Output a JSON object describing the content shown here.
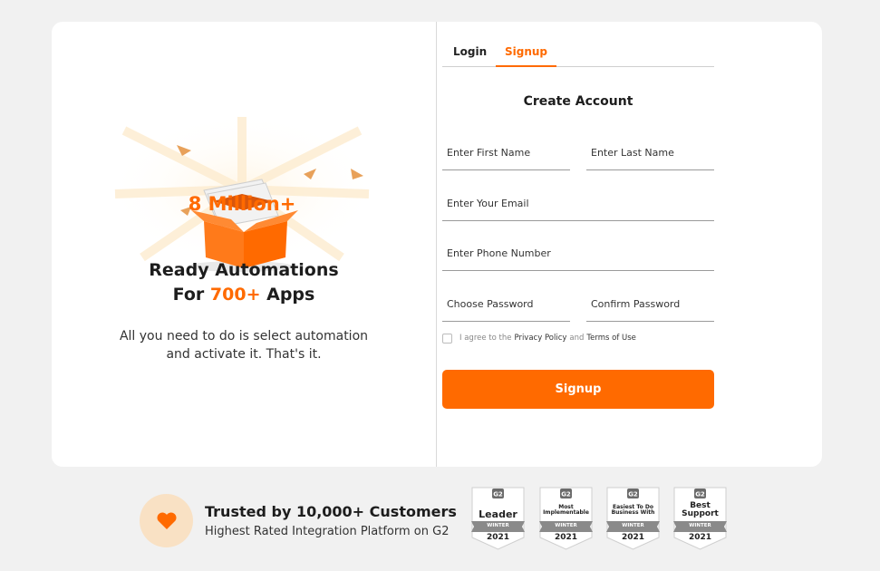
{
  "promo": {
    "art_text": "8 Million+",
    "headline_line1": "Ready Automations",
    "headline_line2_pre": "For ",
    "headline_line2_accent": "700+",
    "headline_line2_post": " Apps",
    "subtext_line1": "All you need to do is select automation",
    "subtext_line2": "and activate it. That's it."
  },
  "tabs": {
    "login": "Login",
    "signup": "Signup",
    "active": "Signup"
  },
  "form": {
    "title": "Create Account",
    "first_name_placeholder": "Enter First Name",
    "last_name_placeholder": "Enter Last Name",
    "email_placeholder": "Enter Your Email",
    "phone_placeholder": "Enter Phone Number",
    "password_placeholder": "Choose Password",
    "confirm_placeholder": "Confirm Password",
    "agree_prefix": "I agree to the",
    "privacy_link": "Privacy Policy",
    "agree_and": "and",
    "terms_link": "Terms of Use",
    "submit_label": "Signup"
  },
  "trust": {
    "icon": "heart-icon",
    "title": "Trusted by 10,000+ Customers",
    "subtitle": "Highest Rated Integration Platform on G2"
  },
  "badges": [
    {
      "line1": "Leader",
      "line2": "",
      "season": "WINTER",
      "year": "2021"
    },
    {
      "line1": "Most",
      "line2": "Implementable",
      "season": "WINTER",
      "year": "2021"
    },
    {
      "line1": "Easiest To Do",
      "line2": "Business With",
      "season": "WINTER",
      "year": "2021"
    },
    {
      "line1": "Best",
      "line2": "Support",
      "season": "WINTER",
      "year": "2021"
    }
  ],
  "colors": {
    "accent": "#ff6a00",
    "background": "#f1f1f1",
    "card": "#ffffff",
    "heart_bg": "#f9e1c4"
  }
}
